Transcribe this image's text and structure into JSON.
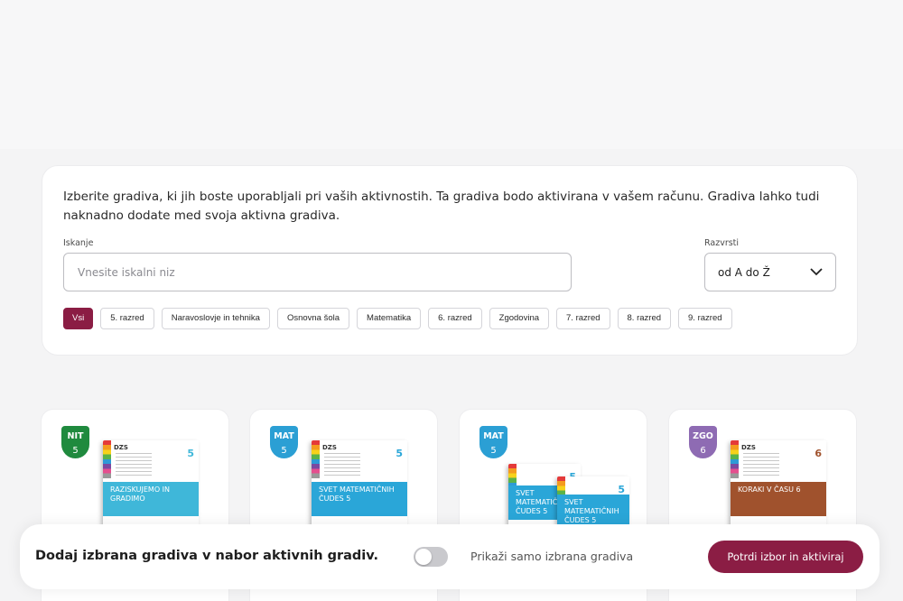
{
  "intro_text": "Izberite gradiva, ki jih boste uporabljali pri vaših aktivnostih. Ta gradiva bodo aktivirana v vašem računu. Gradiva lahko tudi naknadno dodate med svoja aktivna gradiva.",
  "search": {
    "label": "Iskanje",
    "placeholder": "Vnesite iskalni niz",
    "value": ""
  },
  "sort": {
    "label": "Razvrsti",
    "value": "od A do Ž"
  },
  "filters": [
    "Vsi",
    "5. razred",
    "Naravoslovje in tehnika",
    "Osnovna šola",
    "Matematika",
    "6. razred",
    "Zgodovina",
    "7. razred",
    "8. razred",
    "9. razred"
  ],
  "active_filter": "Vsi",
  "books": [
    {
      "subject": "NIT",
      "grade": "5",
      "badge_color": "#1f8a3e",
      "cover_title": "Raziskujemo in gradimo",
      "cover_color": "#3fb7d9",
      "cover_grade": "5"
    },
    {
      "subject": "MAT",
      "grade": "5",
      "badge_color": "#2b9fd4",
      "cover_title": "Svet matematičnih čudes 5",
      "cover_color": "#2aa6d8",
      "cover_grade": "5"
    },
    {
      "subject": "MAT",
      "grade": "5",
      "badge_color": "#2b9fd4",
      "cover_title": "Svet matematičnih čudes 5",
      "cover_color": "#2aa6d8",
      "cover_grade": "5"
    },
    {
      "subject": "ZGO",
      "grade": "6",
      "badge_color": "#8e6bb3",
      "cover_title": "Koraki v času 6",
      "cover_color": "#a0522d",
      "cover_grade": "6"
    }
  ],
  "cover_logo": "DZS",
  "bottom_bar": {
    "title": "Dodaj izbrana gradiva v nabor aktivnih gradiv.",
    "toggle_label": "Prikaži samo izbrana gradiva",
    "toggle_on": false,
    "confirm_label": "Potrdi izbor in aktiviraj"
  },
  "colors": {
    "accent": "#8b1d44"
  }
}
